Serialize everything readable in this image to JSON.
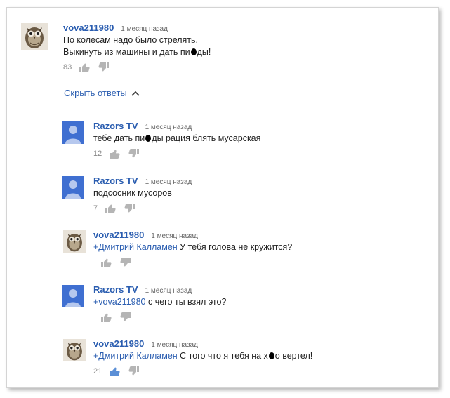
{
  "top_comment": {
    "author": "vova211980",
    "time": "1 месяц назад",
    "line1": "По колесам надо было стрелять.",
    "line2_pre": "Выкинуть из машины и дать пи",
    "line2_post": "ды!",
    "likes": "83",
    "avatar_icon": "owl-avatar"
  },
  "replies_toggle": {
    "label": "Скрыть ответы",
    "icon": "chevron-up-icon"
  },
  "replies": [
    {
      "author": "Razors TV",
      "time": "1 месяц назад",
      "text_pre": "тебе дать пи",
      "text_post": "ды рация блять мусарская",
      "likes": "12",
      "avatar_icon": "default-user-avatar"
    },
    {
      "author": "Razors TV",
      "time": "1 месяц назад",
      "text": "подсосник мусоров",
      "likes": "7",
      "avatar_icon": "default-user-avatar"
    },
    {
      "author": "vova211980",
      "time": "1 месяц назад",
      "mention": "+Дмитрий Калламен",
      "text": " У тебя голова не кружится?",
      "likes": "",
      "avatar_icon": "owl-avatar"
    },
    {
      "author": "Razors TV",
      "time": "1 месяц назад",
      "mention": "+vova211980",
      "text": " с чего ты взял это?",
      "likes": "",
      "avatar_icon": "default-user-avatar"
    },
    {
      "author": "vova211980",
      "time": "1 месяц назад",
      "mention": "+Дмитрий Калламен",
      "text_pre": " С того что я тебя на х",
      "text_post": "о вертел!",
      "likes": "21",
      "avatar_icon": "owl-avatar"
    }
  ],
  "colors": {
    "link": "#2a5db0",
    "text": "#222222",
    "meta": "#666666",
    "icon": "#b5b5b5",
    "default_avatar_bg": "#3f6fd1"
  }
}
